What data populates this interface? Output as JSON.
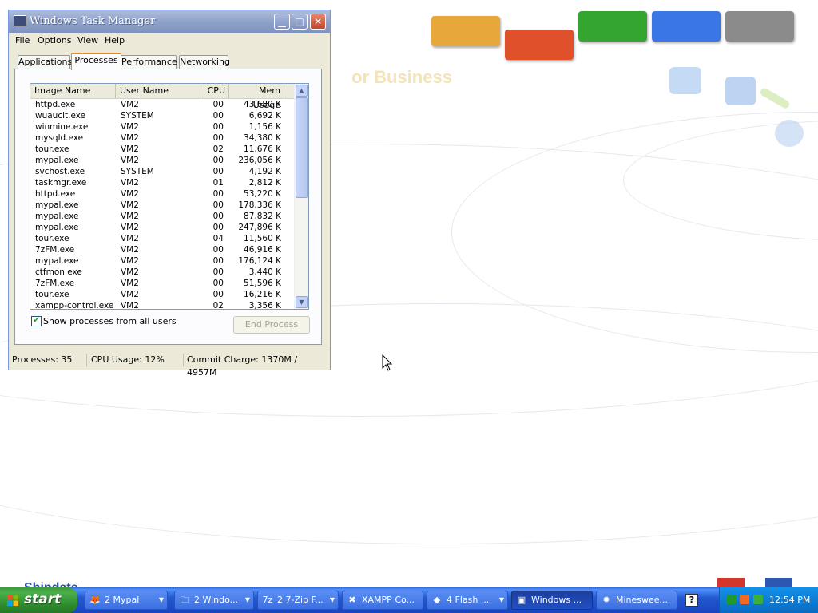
{
  "colors": {
    "tile_orange": "#e8a73a",
    "tile_red": "#e0502a",
    "tile_green": "#35a532",
    "tile_blue": "#3b76e6",
    "tile_gray": "#8b8b8b"
  },
  "desktop": {
    "watermark_text": "or Business",
    "bottom_text": "Shipdate"
  },
  "window": {
    "title": "Windows Task Manager",
    "icon": "monitor-icon",
    "menu": [
      "File",
      "Options",
      "View",
      "Help"
    ],
    "tabs": [
      "Applications",
      "Processes",
      "Performance",
      "Networking"
    ],
    "active_tab": "Processes",
    "columns": {
      "image_name": "Image Name",
      "user_name": "User Name",
      "cpu": "CPU",
      "mem_usage": "Mem Usage"
    },
    "processes": [
      {
        "name": "httpd.exe",
        "user": "VM2",
        "cpu": "00",
        "mem": "43,680 K"
      },
      {
        "name": "wuauclt.exe",
        "user": "SYSTEM",
        "cpu": "00",
        "mem": "6,692 K"
      },
      {
        "name": "winmine.exe",
        "user": "VM2",
        "cpu": "00",
        "mem": "1,156 K"
      },
      {
        "name": "mysqld.exe",
        "user": "VM2",
        "cpu": "00",
        "mem": "34,380 K"
      },
      {
        "name": "tour.exe",
        "user": "VM2",
        "cpu": "02",
        "mem": "11,676 K"
      },
      {
        "name": "mypal.exe",
        "user": "VM2",
        "cpu": "00",
        "mem": "236,056 K"
      },
      {
        "name": "svchost.exe",
        "user": "SYSTEM",
        "cpu": "00",
        "mem": "4,192 K"
      },
      {
        "name": "taskmgr.exe",
        "user": "VM2",
        "cpu": "01",
        "mem": "2,812 K"
      },
      {
        "name": "httpd.exe",
        "user": "VM2",
        "cpu": "00",
        "mem": "53,220 K"
      },
      {
        "name": "mypal.exe",
        "user": "VM2",
        "cpu": "00",
        "mem": "178,336 K"
      },
      {
        "name": "mypal.exe",
        "user": "VM2",
        "cpu": "00",
        "mem": "87,832 K"
      },
      {
        "name": "mypal.exe",
        "user": "VM2",
        "cpu": "00",
        "mem": "247,896 K"
      },
      {
        "name": "tour.exe",
        "user": "VM2",
        "cpu": "04",
        "mem": "11,560 K"
      },
      {
        "name": "7zFM.exe",
        "user": "VM2",
        "cpu": "00",
        "mem": "46,916 K"
      },
      {
        "name": "mypal.exe",
        "user": "VM2",
        "cpu": "00",
        "mem": "176,124 K"
      },
      {
        "name": "ctfmon.exe",
        "user": "VM2",
        "cpu": "00",
        "mem": "3,440 K"
      },
      {
        "name": "7zFM.exe",
        "user": "VM2",
        "cpu": "00",
        "mem": "51,596 K"
      },
      {
        "name": "tour.exe",
        "user": "VM2",
        "cpu": "00",
        "mem": "16,216 K"
      },
      {
        "name": "xampp-control.exe",
        "user": "VM2",
        "cpu": "02",
        "mem": "3,356 K"
      }
    ],
    "show_all_label": "Show processes from all users",
    "show_all_checked": true,
    "end_process_label": "End Process",
    "status": {
      "processes": "Processes: 35",
      "cpu_usage": "CPU Usage: 12%",
      "commit_charge": "Commit Charge: 1370M / 4957M"
    }
  },
  "taskbar": {
    "start_label": "start",
    "tasks": [
      {
        "icon": "mypal-icon",
        "glyph": "🦊",
        "label": "2 Mypal",
        "group": true
      },
      {
        "icon": "folder-icon",
        "glyph": "🗀",
        "label": "2 Windo...",
        "group": true
      },
      {
        "icon": "7zip-icon",
        "glyph": "7z",
        "label": "2 7-Zip F...",
        "group": true
      },
      {
        "icon": "xampp-icon",
        "glyph": "✖",
        "label": "XAMPP Co...",
        "group": false
      },
      {
        "icon": "flash-icon",
        "glyph": "◆",
        "label": "4 Flash ...",
        "group": true
      },
      {
        "icon": "monitor-icon",
        "glyph": "▣",
        "label": "Windows ...",
        "group": false,
        "active": true
      },
      {
        "icon": "minesweeper-icon",
        "glyph": "✹",
        "label": "Mineswee...",
        "group": false
      }
    ],
    "help_glyph": "?",
    "clock": "12:54 PM"
  }
}
